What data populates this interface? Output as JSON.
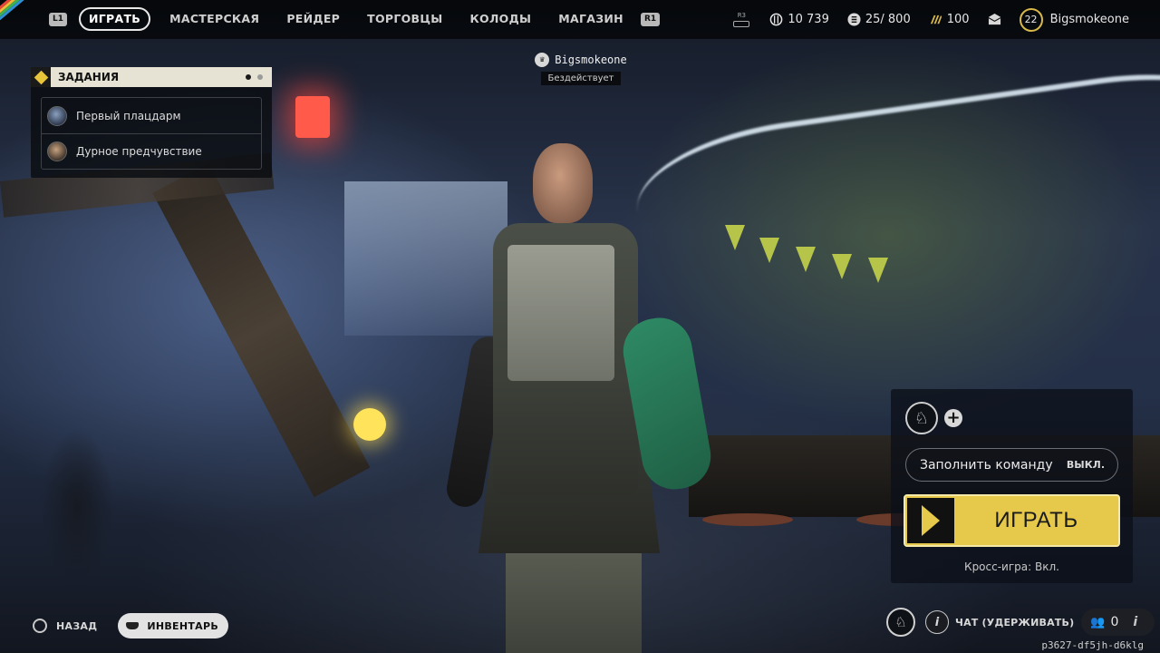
{
  "topbar": {
    "left_hint": "L1",
    "right_hint": "R1",
    "tabs": [
      {
        "label": "ИГРАТЬ",
        "active": true
      },
      {
        "label": "МАСТЕРСКАЯ",
        "active": false
      },
      {
        "label": "РЕЙДЕР",
        "active": false
      },
      {
        "label": "ТОРГОВЦЫ",
        "active": false
      },
      {
        "label": "КОЛОДЫ",
        "active": false
      },
      {
        "label": "МАГАЗИН",
        "active": false
      }
    ],
    "r3_hint": "R3",
    "currency": "10 739",
    "capacity": "25/ 800",
    "tokens": "100",
    "level": "22",
    "username": "Bigsmokeone"
  },
  "quests": {
    "title": "ЗАДАНИЯ",
    "items": [
      "Первый плацдарм",
      "Дурное предчувствие"
    ]
  },
  "player_tag": {
    "name": "Bigsmokeone",
    "status": "Бездействует"
  },
  "party": {
    "fill_team_label": "Заполнить команду",
    "fill_team_value": "ВЫКЛ.",
    "play_label": "ИГРАТЬ",
    "crossplay": "Кросс-игра: Вкл."
  },
  "bottom": {
    "back_label": "НАЗАД",
    "inventory_label": "ИНВЕНТАРЬ",
    "chat_label": "ЧАТ (УДЕРЖИВАТЬ)",
    "friends_count": "0",
    "build_id": "p3627-df5jh-d6klg"
  },
  "colors": {
    "accent_yellow": "#e6c84a",
    "quest_header": "#e6e3d4",
    "ring_gold": "#d8b94a"
  }
}
